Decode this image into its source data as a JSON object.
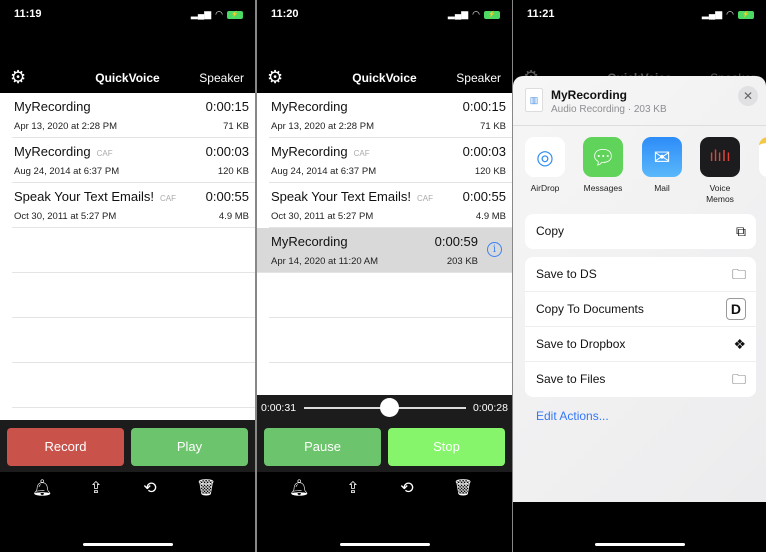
{
  "app": {
    "title": "QuickVoice",
    "speaker": "Speaker"
  },
  "panels": [
    {
      "time": "11:19"
    },
    {
      "time": "11:20"
    },
    {
      "time": "11:21"
    }
  ],
  "recordings": [
    {
      "name": "MyRecording",
      "format": "",
      "duration": "0:00:15",
      "date": "Apr 13, 2020 at 2:28 PM",
      "size": "71 KB"
    },
    {
      "name": "MyRecording",
      "format": "CAF",
      "duration": "0:00:03",
      "date": "Aug 24, 2014 at 6:37 PM",
      "size": "120 KB"
    },
    {
      "name": "Speak Your Text Emails!",
      "format": "CAF",
      "duration": "0:00:55",
      "date": "Oct 30, 2011 at 5:27 PM",
      "size": "4.9 MB"
    },
    {
      "name": "MyRecording",
      "format": "",
      "duration": "0:00:59",
      "date": "Apr 14, 2020 at 11:20 AM",
      "size": "203 KB"
    }
  ],
  "controls": {
    "record": "Record",
    "play": "Play",
    "pause": "Pause",
    "stop": "Stop",
    "colors": {
      "record": "#c9534b",
      "play": "#6cc46c",
      "stop": "#86f56b"
    }
  },
  "player": {
    "elapsed": "0:00:31",
    "remaining": "0:00:28",
    "progress": 0.53
  },
  "toolbar_icons": [
    "bell-icon",
    "share-icon",
    "history-info-icon",
    "trash-icon"
  ],
  "share": {
    "title": "MyRecording",
    "subtitle": "Audio Recording · 203 KB",
    "apps": [
      {
        "label": "AirDrop"
      },
      {
        "label": "Messages"
      },
      {
        "label": "Mail"
      },
      {
        "label": "Voice Memos"
      }
    ],
    "actions_top": [
      {
        "label": "Copy",
        "icon": "copy-icon"
      }
    ],
    "actions": [
      {
        "label": "Save to DS",
        "icon": "folder-search-icon"
      },
      {
        "label": "Copy To Documents",
        "icon": "documents-app-icon"
      },
      {
        "label": "Save to Dropbox",
        "icon": "dropbox-icon"
      },
      {
        "label": "Save to Files",
        "icon": "folder-icon"
      }
    ],
    "edit": "Edit Actions..."
  }
}
